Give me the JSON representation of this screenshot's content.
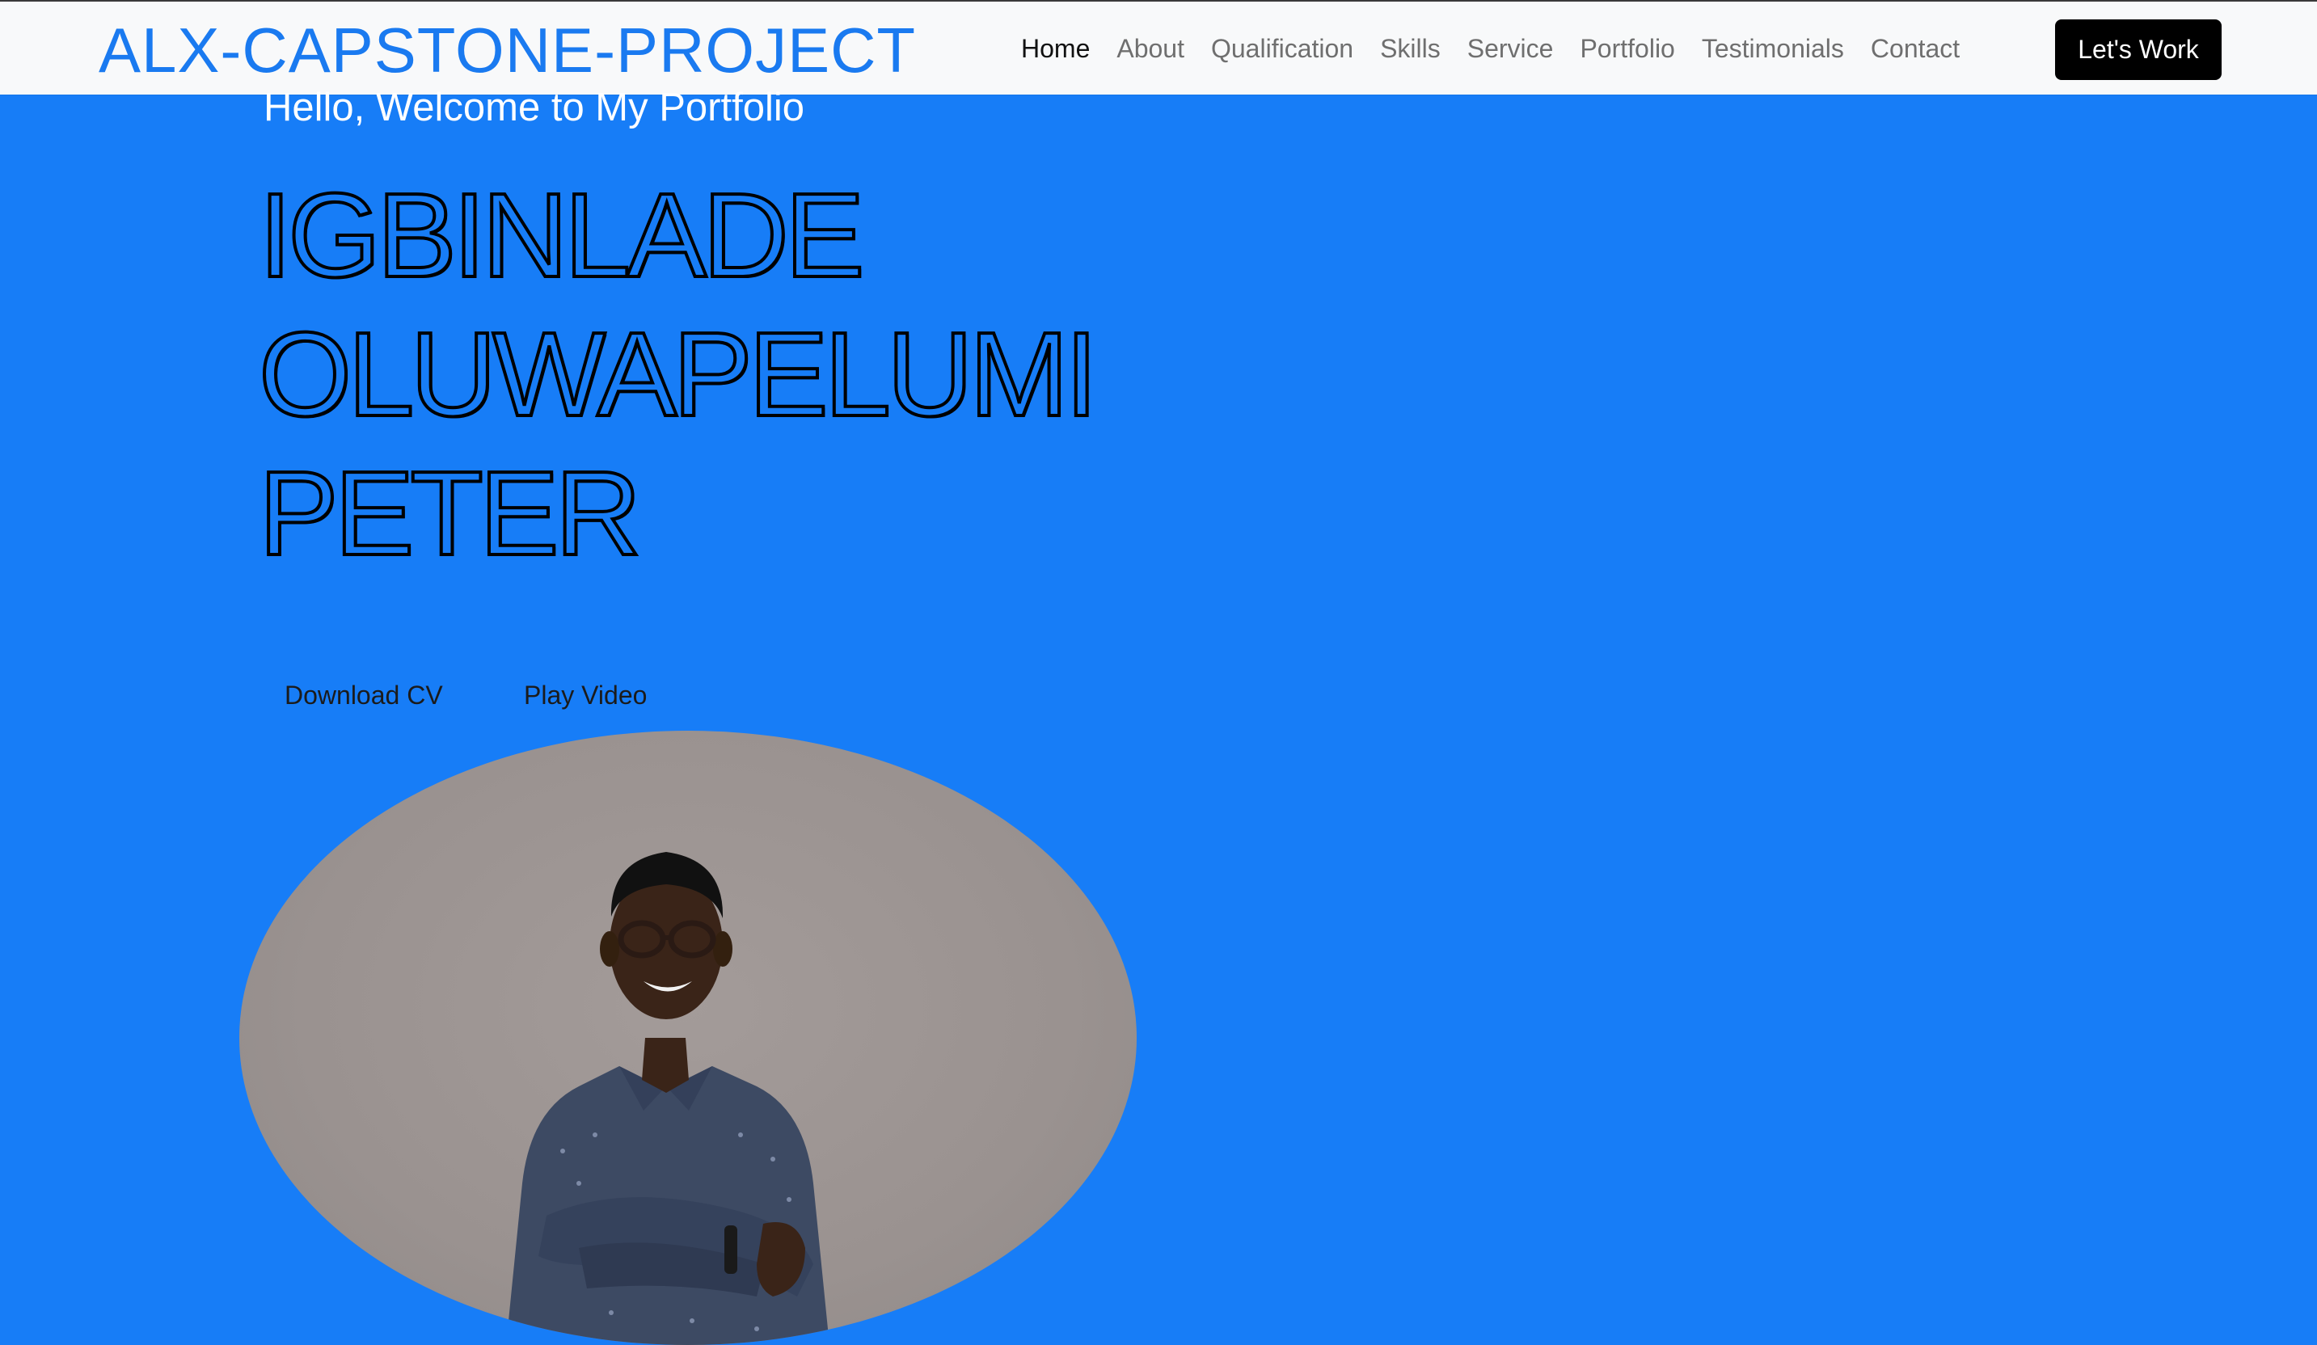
{
  "navbar": {
    "brand": "ALX-CAPSTONE-PROJECT",
    "links": [
      {
        "label": "Home",
        "active": true
      },
      {
        "label": "About"
      },
      {
        "label": "Qualification"
      },
      {
        "label": "Skills"
      },
      {
        "label": "Service"
      },
      {
        "label": "Portfolio"
      },
      {
        "label": "Testimonials"
      },
      {
        "label": "Contact"
      }
    ],
    "cta_label": "Let's Work"
  },
  "hero": {
    "greeting": "Hello, Welcome to My Portfolio",
    "name_lines": [
      "IGBINLADE",
      "OLUWAPELUMI",
      "PETER"
    ],
    "download_cv_label": "Download CV",
    "play_video_label": "Play Video"
  },
  "colors": {
    "hero_background": "#177df7",
    "brand": "#1a7af0",
    "navbar_background": "#f8f9fa",
    "cta_background": "#000000"
  }
}
